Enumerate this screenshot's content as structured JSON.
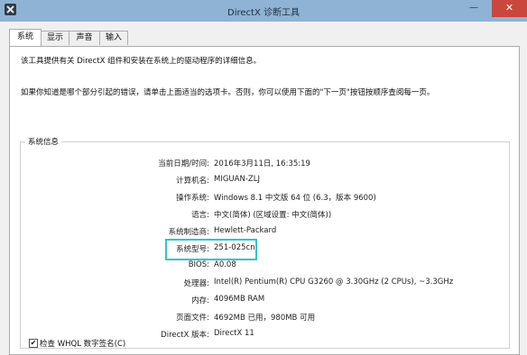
{
  "window": {
    "title": "DirectX 诊断工具",
    "icon": "x-app-icon",
    "controls": {
      "minimize": "—",
      "maximize": "",
      "close": "✕"
    }
  },
  "tabs": [
    {
      "label": "系统",
      "active": true
    },
    {
      "label": "显示",
      "active": false
    },
    {
      "label": "声音",
      "active": false
    },
    {
      "label": "输入",
      "active": false
    }
  ],
  "description": {
    "line1": "该工具提供有关 DirectX 组件和安装在系统上的驱动程序的详细信息。",
    "line2": "如果你知道是哪个部分引起的错误，请单击上面适当的选项卡。否则，你可以使用下面的\"下一页\"按钮按顺序查阅每一页。"
  },
  "system_info": {
    "group_title": "系统信息",
    "rows": [
      {
        "label": "当前日期/时间:",
        "value": "2016年3月11日, 16:35:19"
      },
      {
        "label": "计算机名:",
        "value": "MIGUAN-ZLJ"
      },
      {
        "label": "操作系统:",
        "value": "Windows 8.1 中文版 64 位 (6.3，版本 9600)"
      },
      {
        "label": "语言:",
        "value": "中文(简体) (区域设置: 中文(简体))"
      },
      {
        "label": "系统制造商:",
        "value": "Hewlett-Packard"
      },
      {
        "label": "系统型号:",
        "value": "251-025cn"
      },
      {
        "label": "BIOS:",
        "value": "A0.08"
      },
      {
        "label": "处理器:",
        "value": "Intel(R) Pentium(R) CPU G3260 @ 3.30GHz (2 CPUs), ~3.3GHz"
      },
      {
        "label": "内存:",
        "value": "4096MB RAM"
      },
      {
        "label": "页面文件:",
        "value": "4692MB 已用，980MB 可用"
      },
      {
        "label": "DirectX 版本:",
        "value": "DirectX 11"
      }
    ],
    "highlight_color": "#33c2cf"
  },
  "whql_checkbox": {
    "label": "检查 WHQL 数字签名(C)",
    "checked": true,
    "mark": "✔"
  }
}
